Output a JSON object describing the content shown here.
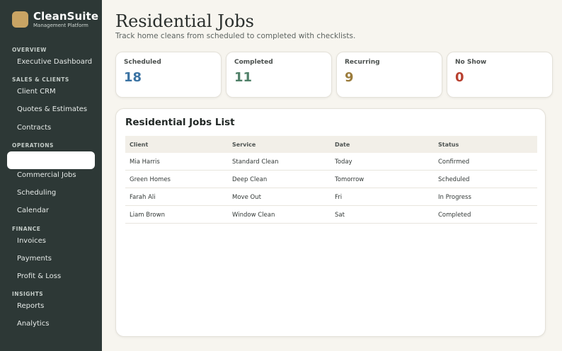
{
  "brand": {
    "name": "CleanSuite",
    "subtitle": "Management Platform"
  },
  "sidebar": {
    "overview_label": "OVERVIEW",
    "executive_dashboard": "Executive Dashboard",
    "sales_label": "SALES & CLIENTS",
    "client_crm": "Client CRM",
    "quotes": "Quotes & Estimates",
    "contracts": "Contracts",
    "operations_label": "OPERATIONS",
    "commercial_jobs": "Commercial Jobs",
    "scheduling": "Scheduling",
    "calendar": "Calendar",
    "finance_label": "FINANCE",
    "invoices": "Invoices",
    "payments": "Payments",
    "profit_loss": "Profit & Loss",
    "insights_label": "INSIGHTS",
    "reports": "Reports",
    "analytics": "Analytics"
  },
  "header": {
    "title": "Residential Jobs",
    "subtitle": "Track home cleans from scheduled to completed with checklists."
  },
  "stats": [
    {
      "label": "Scheduled",
      "value": "18",
      "color": "#3b73a3"
    },
    {
      "label": "Completed",
      "value": "11",
      "color": "#4f8068"
    },
    {
      "label": "Recurring",
      "value": "9",
      "color": "#9b7c3c"
    },
    {
      "label": "No Show",
      "value": "0",
      "color": "#b8402f"
    }
  ],
  "table": {
    "title": "Residential Jobs List",
    "columns": [
      "Client",
      "Service",
      "Date",
      "Status"
    ],
    "rows": [
      [
        "Mia Harris",
        "Standard Clean",
        "Today",
        "Confirmed"
      ],
      [
        "Green Homes",
        "Deep Clean",
        "Tomorrow",
        "Scheduled"
      ],
      [
        "Farah Ali",
        "Move Out",
        "Fri",
        "In Progress"
      ],
      [
        "Liam Brown",
        "Window Clean",
        "Sat",
        "Completed"
      ]
    ]
  }
}
